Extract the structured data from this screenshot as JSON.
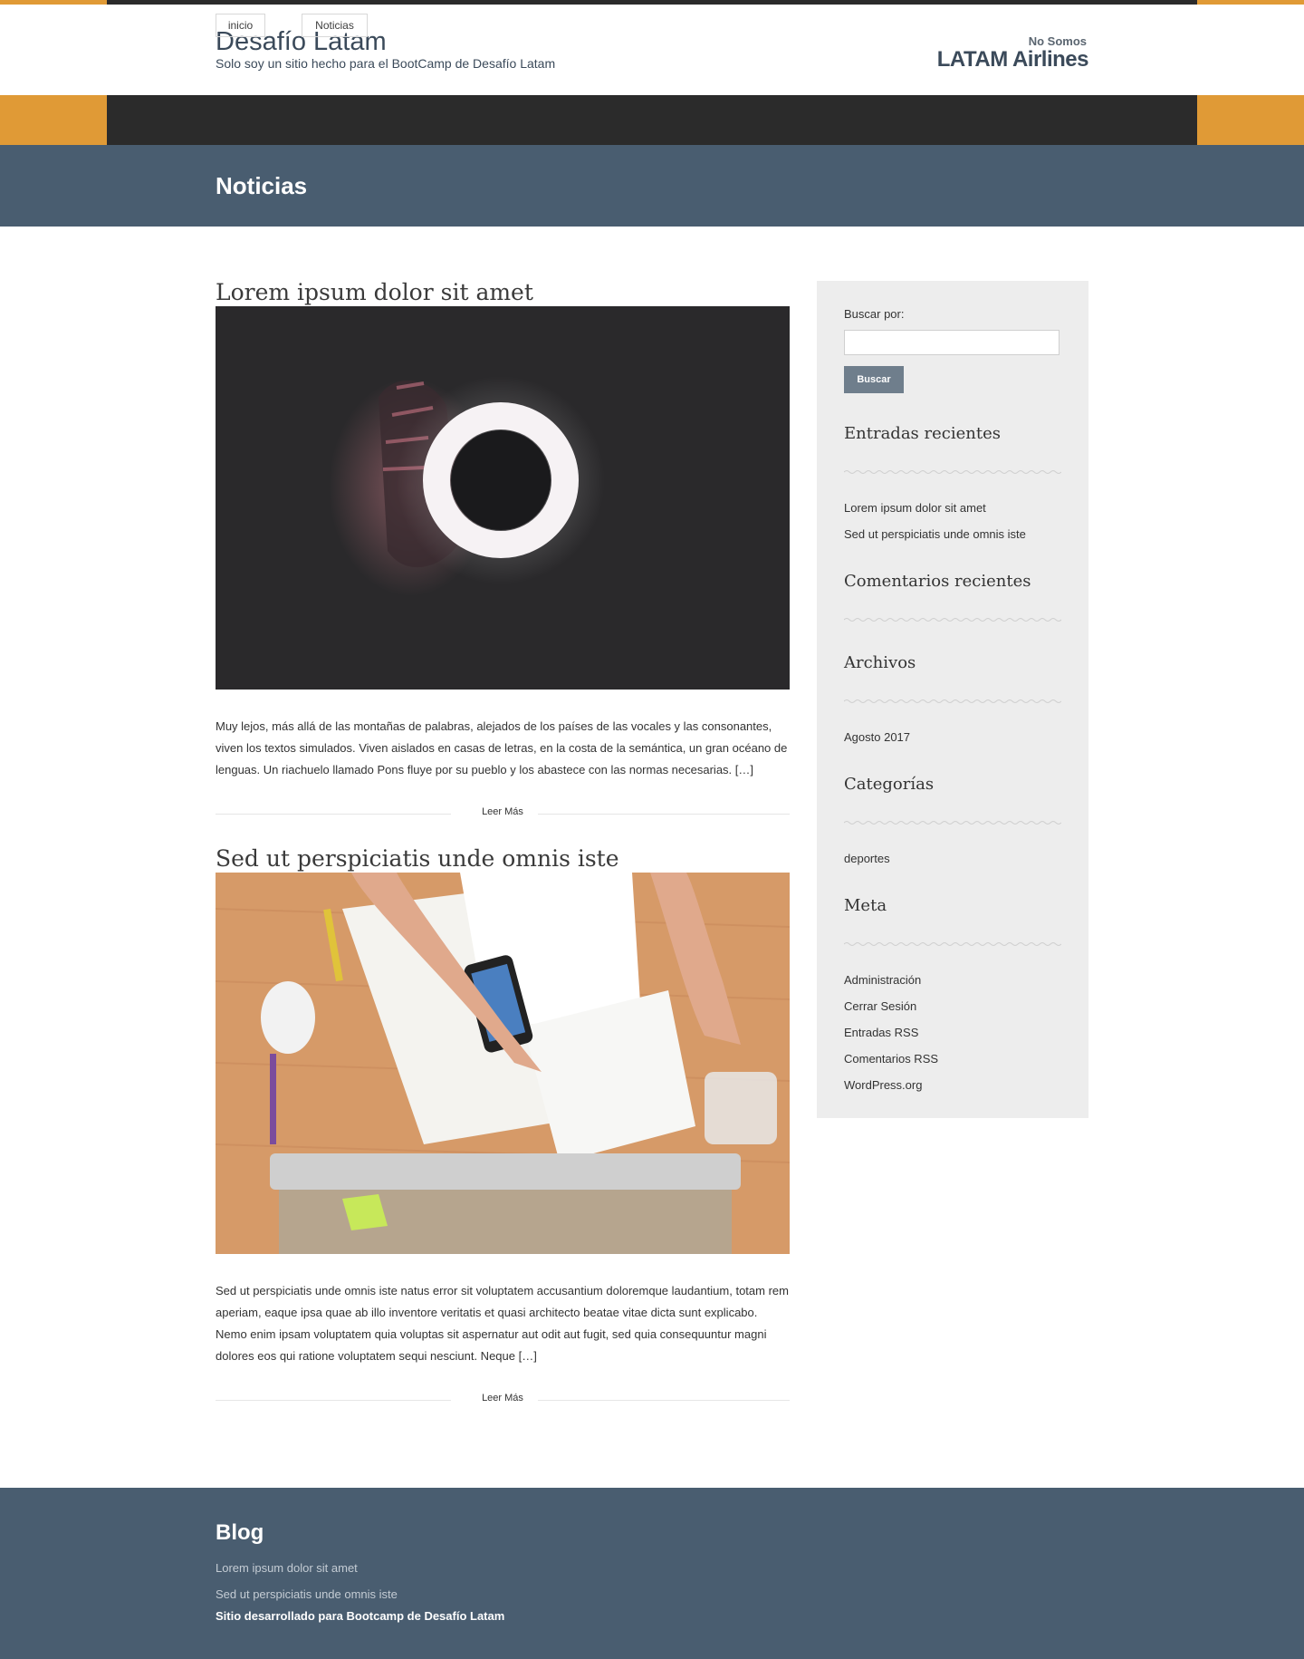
{
  "site": {
    "title": "Desafío Latam",
    "tagline": "Solo soy un sitio hecho para el BootCamp de Desafío Latam",
    "right_small": "No Somos",
    "right_big": "LATAM Airlines"
  },
  "nav": {
    "items": [
      {
        "label": "inicio"
      },
      {
        "label": "Noticias"
      }
    ]
  },
  "page": {
    "title": "Noticias"
  },
  "posts": [
    {
      "title": "Lorem ipsum dolor sit amet",
      "excerpt": "Muy lejos, más allá de las montañas de palabras, alejados de los países de las vocales y las consonantes, viven los textos simulados. Viven aislados en casas de letras, en la costa de la semántica, un gran océano de lenguas. Un riachuelo llamado Pons fluye por su pueblo y los abastece con las normas necesarias. […]",
      "read_more": "Leer Más"
    },
    {
      "title": "Sed ut perspiciatis unde omnis iste",
      "excerpt": "Sed ut perspiciatis unde omnis iste natus error sit voluptatem accusantium doloremque laudantium, totam rem aperiam, eaque ipsa quae ab illo inventore veritatis et quasi architecto beatae vitae dicta sunt explicabo. Nemo enim ipsam voluptatem quia voluptas sit aspernatur aut odit aut fugit, sed quia consequuntur magni dolores eos qui ratione voluptatem sequi nesciunt. Neque […]",
      "read_more": "Leer Más"
    }
  ],
  "sidebar": {
    "search_label": "Buscar por:",
    "search_value": "",
    "search_button": "Buscar",
    "recent_posts_heading": "Entradas recientes",
    "recent_posts": [
      "Lorem ipsum dolor sit amet",
      "Sed ut perspiciatis unde omnis iste"
    ],
    "recent_comments_heading": "Comentarios recientes",
    "archives_heading": "Archivos",
    "archives": [
      "Agosto 2017"
    ],
    "categories_heading": "Categorías",
    "categories": [
      "deportes"
    ],
    "meta_heading": "Meta",
    "meta": [
      "Administración",
      "Cerrar Sesión",
      "Entradas RSS",
      "Comentarios RSS",
      "WordPress.org"
    ]
  },
  "footer": {
    "title": "Blog",
    "links": [
      "Lorem ipsum dolor sit amet",
      "Sed ut perspiciatis unde omnis iste"
    ],
    "credit": "Sitio desarrollado para Bootcamp de Desafío Latam"
  },
  "colors": {
    "accent_orange": "#e09a36",
    "dark_bar": "#2b2b2b",
    "slate_blue": "#495d70",
    "sidebar_bg": "#ededed",
    "button_gray": "#6f7e8c"
  }
}
